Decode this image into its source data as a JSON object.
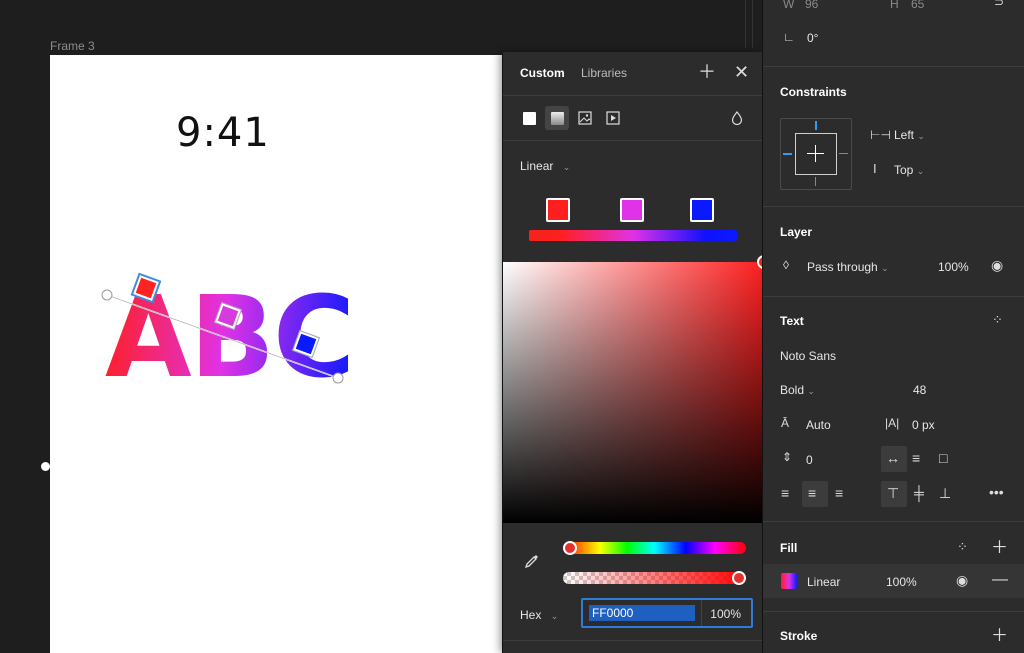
{
  "canvas": {
    "frame_label": "Frame 3",
    "time_text": "9:41",
    "word_text": "ABC"
  },
  "picker": {
    "tabs": {
      "custom": "Custom",
      "libraries": "Libraries"
    },
    "gradient_mode": "Linear",
    "stops": [
      "#ff1f1f",
      "#e032e6",
      "#0a1aff"
    ],
    "hex_label": "Hex",
    "hex_value": "FF0000",
    "opacity": "100%"
  },
  "panel": {
    "dims": {
      "w_label": "W",
      "w_value": "96",
      "h_label": "H",
      "h_value": "65"
    },
    "rotation": "0°",
    "constraints": {
      "title": "Constraints",
      "horizontal": "Left",
      "vertical": "Top"
    },
    "layer": {
      "title": "Layer",
      "blend": "Pass through",
      "opacity": "100%"
    },
    "text": {
      "title": "Text",
      "font": "Noto Sans",
      "weight": "Bold",
      "size": "48",
      "line_height": "Auto",
      "letter_spacing": "0 px",
      "paragraph_spacing": "0"
    },
    "fill": {
      "title": "Fill",
      "type": "Linear",
      "opacity": "100%"
    },
    "stroke": {
      "title": "Stroke"
    }
  },
  "colors": {
    "accent": "#2f7bd8",
    "panel_bg": "#2c2c2c",
    "canvas_bg": "#1e1e1e"
  }
}
